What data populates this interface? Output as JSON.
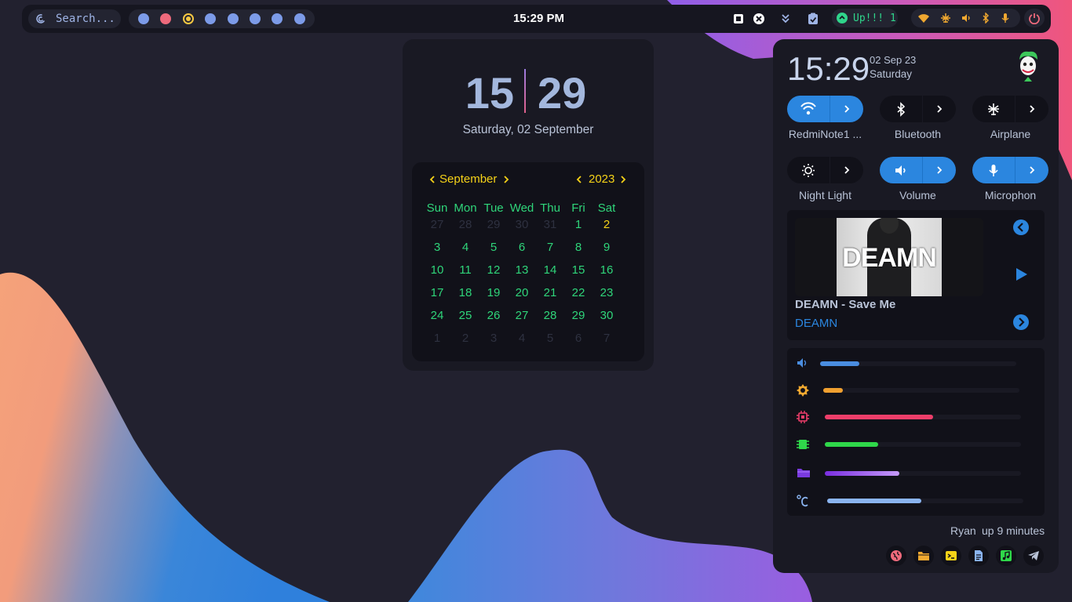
{
  "topbar": {
    "search_placeholder": "Search...",
    "clock": "15:29 PM",
    "updates_label": "Up!!! 1",
    "workspaces": [
      {
        "color": "#7c9be8",
        "state": "normal"
      },
      {
        "color": "#ee6a7c",
        "state": "urgent"
      },
      {
        "color": "#f5c842",
        "state": "active"
      },
      {
        "color": "#7c9be8",
        "state": "normal"
      },
      {
        "color": "#7c9be8",
        "state": "normal"
      },
      {
        "color": "#7c9be8",
        "state": "normal"
      },
      {
        "color": "#7c9be8",
        "state": "normal"
      },
      {
        "color": "#7c9be8",
        "state": "normal"
      }
    ],
    "tray_icons": [
      "screenshot-icon",
      "close-icon",
      "chevrons-down-icon",
      "clipboard-check-icon"
    ],
    "status_icons": [
      "wifi-icon",
      "airplane-icon",
      "volume-icon",
      "bluetooth-icon",
      "microphone-icon"
    ]
  },
  "clock_widget": {
    "hours": "15",
    "minutes": "29",
    "date": "Saturday, 02 September",
    "calendar": {
      "month": "September",
      "year": "2023",
      "weekdays": [
        "Sun",
        "Mon",
        "Tue",
        "Wed",
        "Thu",
        "Fri",
        "Sat"
      ],
      "weeks": [
        [
          {
            "d": "27",
            "s": "mute"
          },
          {
            "d": "28",
            "s": "mute"
          },
          {
            "d": "29",
            "s": "mute"
          },
          {
            "d": "30",
            "s": "mute"
          },
          {
            "d": "31",
            "s": "mute"
          },
          {
            "d": "1",
            "s": "day"
          },
          {
            "d": "2",
            "s": "today"
          }
        ],
        [
          {
            "d": "3",
            "s": "day"
          },
          {
            "d": "4",
            "s": "day"
          },
          {
            "d": "5",
            "s": "day"
          },
          {
            "d": "6",
            "s": "day"
          },
          {
            "d": "7",
            "s": "day"
          },
          {
            "d": "8",
            "s": "day"
          },
          {
            "d": "9",
            "s": "day"
          }
        ],
        [
          {
            "d": "10",
            "s": "day"
          },
          {
            "d": "11",
            "s": "day"
          },
          {
            "d": "12",
            "s": "day"
          },
          {
            "d": "13",
            "s": "day"
          },
          {
            "d": "14",
            "s": "day"
          },
          {
            "d": "15",
            "s": "day"
          },
          {
            "d": "16",
            "s": "day"
          }
        ],
        [
          {
            "d": "17",
            "s": "day"
          },
          {
            "d": "18",
            "s": "day"
          },
          {
            "d": "19",
            "s": "day"
          },
          {
            "d": "20",
            "s": "day"
          },
          {
            "d": "21",
            "s": "day"
          },
          {
            "d": "22",
            "s": "day"
          },
          {
            "d": "23",
            "s": "day"
          }
        ],
        [
          {
            "d": "24",
            "s": "day"
          },
          {
            "d": "25",
            "s": "day"
          },
          {
            "d": "26",
            "s": "day"
          },
          {
            "d": "27",
            "s": "day"
          },
          {
            "d": "28",
            "s": "day"
          },
          {
            "d": "29",
            "s": "day"
          },
          {
            "d": "30",
            "s": "day"
          }
        ],
        [
          {
            "d": "1",
            "s": "mute"
          },
          {
            "d": "2",
            "s": "mute"
          },
          {
            "d": "3",
            "s": "mute"
          },
          {
            "d": "4",
            "s": "mute"
          },
          {
            "d": "5",
            "s": "mute"
          },
          {
            "d": "6",
            "s": "mute"
          },
          {
            "d": "7",
            "s": "mute"
          }
        ]
      ]
    }
  },
  "panel": {
    "time": "15:29",
    "date": "02 Sep 23",
    "day": "Saturday",
    "toggles": [
      {
        "label": "RedmiNote1 ...",
        "icon": "wifi-icon",
        "active": true
      },
      {
        "label": "Bluetooth",
        "icon": "bluetooth-icon",
        "active": false
      },
      {
        "label": "Airplane",
        "icon": "airplane-icon",
        "active": false
      },
      {
        "label": "Night Light",
        "icon": "brightness-icon",
        "active": false
      },
      {
        "label": "Volume",
        "icon": "volume-icon",
        "active": true
      },
      {
        "label": "Microphon",
        "icon": "microphone-icon",
        "active": true
      }
    ],
    "player": {
      "cover_text": "DEAMN",
      "title": "DEAMN - Save Me",
      "artist": "DEAMN"
    },
    "meters": [
      {
        "name": "volume",
        "icon": "volume-icon",
        "level": 0.2,
        "color": "#4a8de0"
      },
      {
        "name": "brightness",
        "icon": "brightness-icon",
        "level": 0.1,
        "color": "#f0a030"
      },
      {
        "name": "cpu",
        "icon": "cpu-icon",
        "level": 0.55,
        "color": "#ee3e6a"
      },
      {
        "name": "ram",
        "icon": "memory-icon",
        "level": 0.27,
        "color": "#2fd84a"
      },
      {
        "name": "disk",
        "icon": "folder-icon",
        "level": 0.38,
        "color": "#9a5ef0"
      },
      {
        "name": "temperature",
        "icon": "temperature-icon",
        "level": 0.48,
        "color": "#8ab4f0"
      }
    ],
    "user": "Ryan",
    "uptime": "up 9 minutes",
    "apps": [
      "browser-icon",
      "files-icon",
      "terminal-icon",
      "editor-icon",
      "music-icon",
      "telegram-icon"
    ]
  },
  "colors": {
    "accent": "#2b86df",
    "calendar_day": "#2fd57a",
    "calendar_today": "#f5d218"
  }
}
